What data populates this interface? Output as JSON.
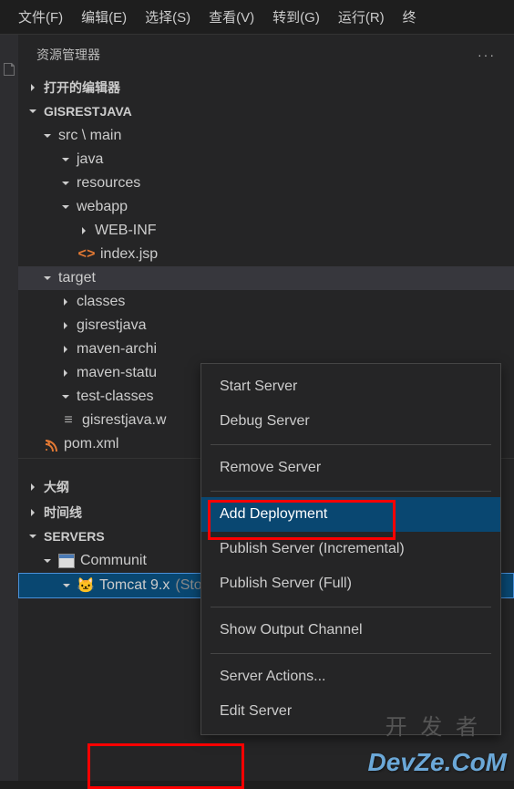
{
  "menubar": {
    "file": "文件(F)",
    "edit": "编辑(E)",
    "select": "选择(S)",
    "view": "查看(V)",
    "goto": "转到(G)",
    "run": "运行(R)",
    "terminal": "终"
  },
  "sidebar": {
    "title": "资源管理器",
    "open_editors": "打开的编辑器",
    "project_name": "GISRESTJAVA",
    "outline": "大纲",
    "timeline": "时间线",
    "servers": "SERVERS"
  },
  "tree": {
    "src_main": "src \\ main",
    "java": "java",
    "resources": "resources",
    "webapp": "webapp",
    "web_inf": "WEB-INF",
    "index_jsp": "index.jsp",
    "target": "target",
    "classes": "classes",
    "gisrestjava": "gisrestjava",
    "maven_archi": "maven-archi",
    "maven_statu": "maven-statu",
    "test_classes": "test-classes",
    "gisrestjava_w": "gisrestjava.w",
    "pom_xml": "pom.xml"
  },
  "servers_tree": {
    "community": "Communit",
    "tomcat": "Tomcat 9.x",
    "tomcat_status": "(Stopped) (Synchronized)"
  },
  "context_menu": {
    "start": "Start Server",
    "debug": "Debug Server",
    "remove": "Remove Server",
    "add_deployment": "Add Deployment",
    "publish_inc": "Publish Server (Incremental)",
    "publish_full": "Publish Server (Full)",
    "show_output": "Show Output Channel",
    "server_actions": "Server Actions...",
    "edit_server": "Edit Server"
  },
  "watermark": {
    "chars": "开 发 者",
    "domain": "DevZe.CoM"
  }
}
